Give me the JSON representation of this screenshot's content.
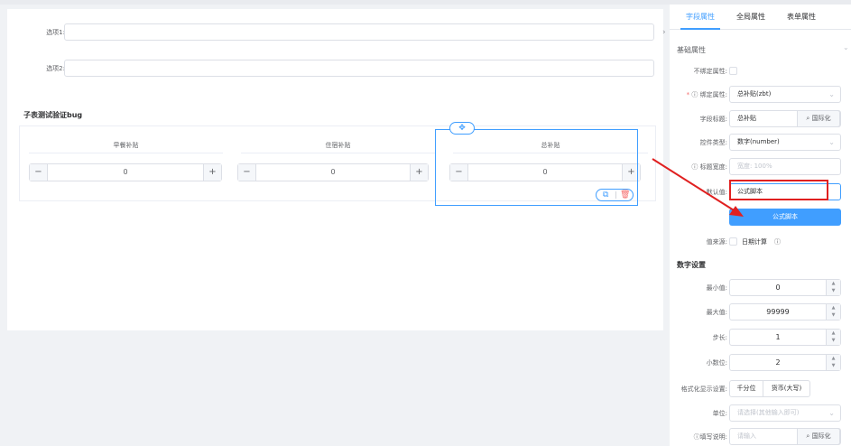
{
  "form": {
    "option1_label": "选项1:",
    "option2_label": "选项2:",
    "subtable_title": "子表测试验证bug",
    "columns": [
      {
        "header": "早餐补贴",
        "value": "0"
      },
      {
        "header": "住宿补贴",
        "value": "0"
      },
      {
        "header": "总补贴",
        "value": "0"
      }
    ],
    "minus": "−",
    "plus": "+"
  },
  "panel": {
    "tabs": [
      {
        "label": "字段属性",
        "active": true
      },
      {
        "label": "全局属性",
        "active": false
      },
      {
        "label": "表单属性",
        "active": false
      }
    ],
    "basic_section": "基础属性",
    "unbind_label": "不绑定属性:",
    "bind_label": "绑定属性:",
    "bind_value": "总补贴(zbt)",
    "title_label": "字段标题:",
    "title_value": "总补贴",
    "intl_label": "国际化",
    "control_type_label": "控件类型:",
    "control_type_value": "数字(number)",
    "title_width_label": "标题宽度:",
    "title_width_placeholder": "宽度: 100%",
    "default_label": "默认值:",
    "default_value": "公式脚本",
    "formula_button": "公式脚本",
    "value_source_label": "值来源:",
    "date_calc_label": "日期计算",
    "number_section": "数字设置",
    "min_label": "最小值:",
    "min_value": "0",
    "max_label": "最大值:",
    "max_value": "99999",
    "step_label": "步长:",
    "step_value": "1",
    "decimal_label": "小数位:",
    "decimal_value": "2",
    "format_label": "格式化显示设置:",
    "format_thousand": "千分位",
    "format_currency": "货币(大写)",
    "unit_label": "单位:",
    "unit_placeholder": "请选择(其他输入即可)",
    "help_label": "填写说明:",
    "help_placeholder": "请输入",
    "help_intl": "国际化"
  },
  "colors": {
    "accent": "#409eff",
    "danger": "#f56c6c",
    "annotation": "#e02020"
  }
}
